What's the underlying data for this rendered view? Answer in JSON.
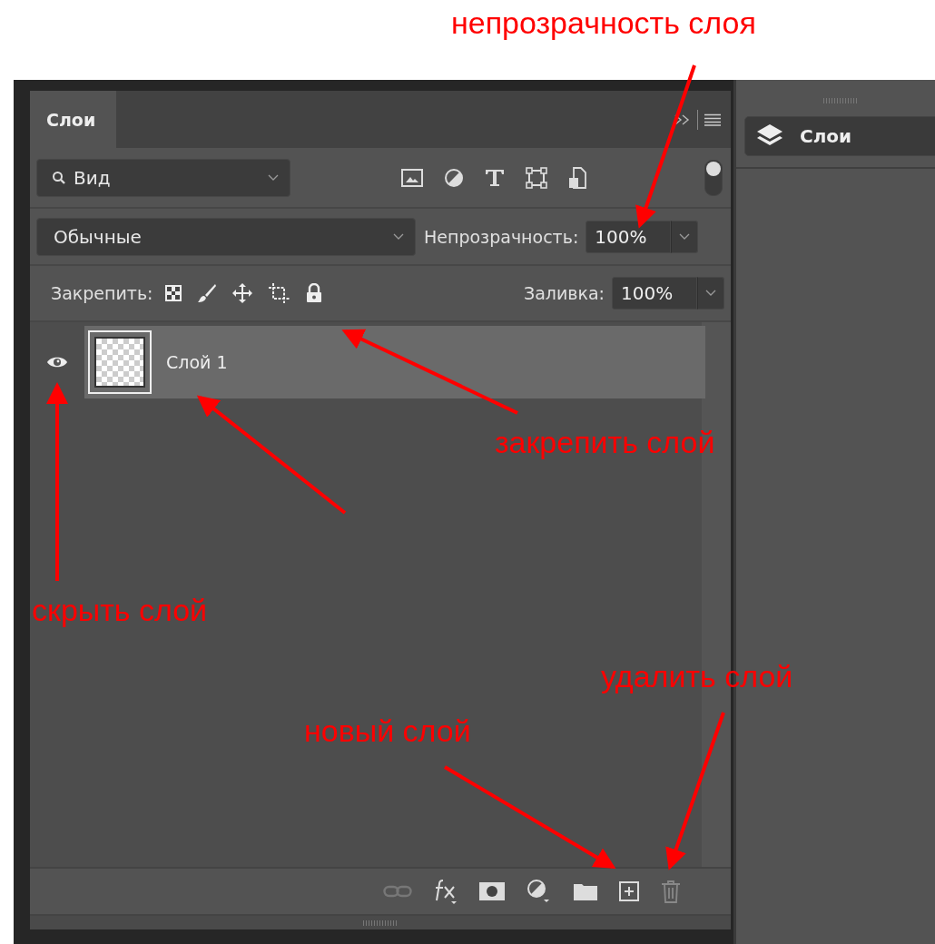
{
  "panel": {
    "tabs": [
      {
        "label": "Слои",
        "selected": true
      }
    ],
    "filter": {
      "value": "Вид"
    },
    "blend_mode": "Обычные",
    "opacity": {
      "label": "Непрозрачность:",
      "value": "100%"
    },
    "lock": {
      "label": "Закрепить:"
    },
    "fill": {
      "label": "Заливка:",
      "value": "100%"
    },
    "layers": [
      {
        "name": "Слой 1",
        "visible": true,
        "selected": true
      }
    ]
  },
  "side_panel": {
    "button": "Слои"
  },
  "annotations": [
    {
      "label": "непрозрачность слоя"
    },
    {
      "label": "закрепить слой"
    },
    {
      "label": "скрыть слой"
    },
    {
      "label": "удалить слой"
    },
    {
      "label": "новый слой"
    }
  ]
}
